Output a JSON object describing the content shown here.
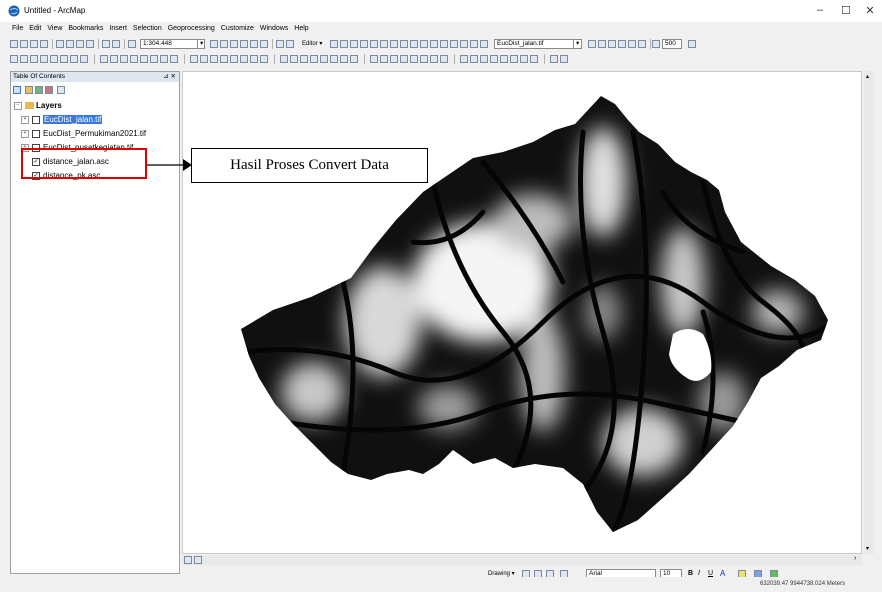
{
  "window": {
    "title": "Untitled - ArcMap",
    "minimize": "–",
    "maximize": "☐",
    "close": "✕"
  },
  "menu": [
    "File",
    "Edit",
    "View",
    "Bookmarks",
    "Insert",
    "Selection",
    "Geoprocessing",
    "Customize",
    "Windows",
    "Help"
  ],
  "toolbar": {
    "scale": "1:304.448",
    "editor": "Editor ▾",
    "layer_select": "EucDist_jalan.tif",
    "zoom_value": "500"
  },
  "toc": {
    "title": "Table Of Contents",
    "pin": "⊿ ✕",
    "root": "Layers",
    "layers": [
      {
        "name": "EucDist_jalan.tif",
        "checked": false,
        "selected": true
      },
      {
        "name": "EucDist_Permukiman2021.tif",
        "checked": false,
        "selected": false
      },
      {
        "name": "EucDist_pusatkegiatan.tif",
        "checked": false,
        "selected": false
      },
      {
        "name": "distance_jalan.asc",
        "checked": true,
        "selected": false
      },
      {
        "name": "distance_pk.asc",
        "checked": true,
        "selected": false
      }
    ]
  },
  "annotation": {
    "callout": "Hasil Proses Convert Data"
  },
  "drawing": {
    "label": "Drawing ▾",
    "font": "Arial",
    "size": "10"
  },
  "status": {
    "coords": "632039.47  9944738.024 Meters"
  },
  "colors": {
    "highlight": "#3a78d8",
    "annotation_red": "#e00000"
  }
}
